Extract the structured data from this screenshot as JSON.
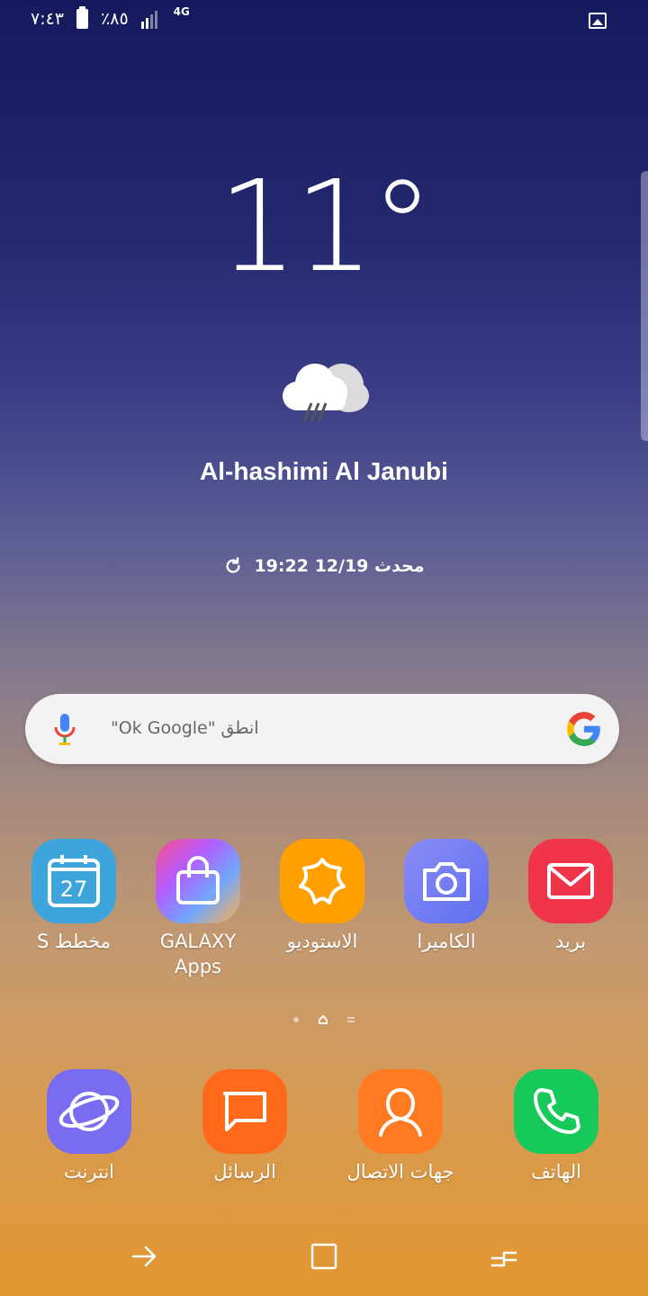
{
  "status_bar": {
    "time": "٧:٤٣",
    "battery": "٪٨٥",
    "network": "4G"
  },
  "weather": {
    "temperature": "11°",
    "location": "Al-hashimi Al Janubi",
    "updated": "محدث 12/19 19:22",
    "icon": "rain-cloud-icon"
  },
  "search": {
    "placeholder": "انطق \"Ok Google\""
  },
  "apps_row": [
    {
      "label": "مخطط S",
      "icon": "calendar-icon",
      "badge": "27"
    },
    {
      "label": "GALAXY Apps",
      "icon": "shopping-bag-icon"
    },
    {
      "label": "الاستوديو",
      "icon": "gallery-flower-icon"
    },
    {
      "label": "الكاميرا",
      "icon": "camera-icon"
    },
    {
      "label": "بريد",
      "icon": "mail-icon"
    }
  ],
  "dock": [
    {
      "label": "انترنت",
      "icon": "internet-planet-icon"
    },
    {
      "label": "الرسائل",
      "icon": "message-icon"
    },
    {
      "label": "جهات الاتصال",
      "icon": "contacts-icon"
    },
    {
      "label": "الهاتف",
      "icon": "phone-icon"
    }
  ],
  "colors": {
    "calendar": "#3ea4dc",
    "studio": "#ffa000",
    "camera": "#6b7cf0",
    "mail": "#f0344a",
    "internet": "#7a6cf0",
    "messages": "#ff6a1a",
    "contacts": "#ff7a20",
    "phone": "#16c95a"
  }
}
